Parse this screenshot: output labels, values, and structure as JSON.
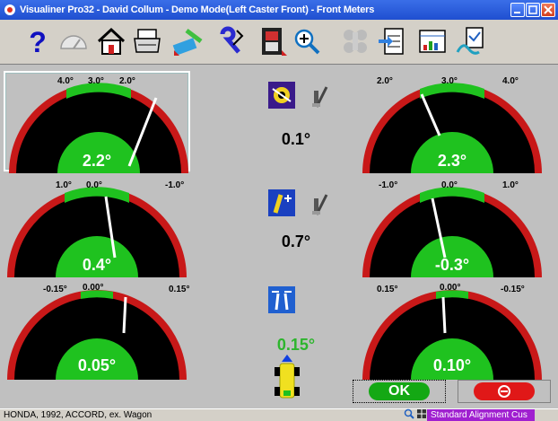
{
  "window": {
    "title": "Visualiner Pro32 - David Collum - Demo Mode(Left Caster Front) - Front Meters"
  },
  "toolbar": {
    "buttons": [
      {
        "icon": "help-icon"
      },
      {
        "icon": "gauge-icon"
      },
      {
        "icon": "home-icon"
      },
      {
        "icon": "printer-icon"
      },
      {
        "icon": "measure-icon"
      },
      {
        "icon": "wrench-icon"
      },
      {
        "icon": "film-icon"
      },
      {
        "icon": "zoom-icon"
      },
      {
        "icon": "wheels-icon"
      },
      {
        "icon": "clipboard-icon"
      },
      {
        "icon": "chart-icon"
      },
      {
        "icon": "report-icon"
      }
    ]
  },
  "gauges": {
    "left_caster": {
      "min_label": "4.0°",
      "center_label": "3.0°",
      "max_label": "2.0°",
      "value": "2.2°"
    },
    "right_caster": {
      "min_label": "2.0°",
      "center_label": "3.0°",
      "max_label": "4.0°",
      "value": "2.3°"
    },
    "left_camber": {
      "min_label": "1.0°",
      "center_label": "0.0°",
      "max_label": "-1.0°",
      "value": "0.4°"
    },
    "right_camber": {
      "min_label": "-1.0°",
      "center_label": "0.0°",
      "max_label": "1.0°",
      "value": "-0.3°"
    },
    "left_toe": {
      "min_label": "-0.15°",
      "center_label": "0.00°",
      "max_label": "0.15°",
      "value": "0.05°"
    },
    "right_toe": {
      "min_label": "0.15°",
      "center_label": "0.00°",
      "max_label": "-0.15°",
      "value": "0.10°"
    }
  },
  "center": {
    "caster_cross": "0.1°",
    "camber_cross": "0.7°",
    "total_toe": "0.15°"
  },
  "buttons": {
    "ok_label": "OK"
  },
  "statusbar": {
    "vehicle": "HONDA, 1992, ACCORD, ex. Wagon",
    "spec": "Standard Alignment Cus"
  },
  "colors": {
    "title_blue": "#1f4fd0",
    "gauge_green": "#1fc21f",
    "gauge_red": "#c81818",
    "ok_green": "#14a814",
    "cancel_red": "#e01818",
    "status_purple": "#a020d0"
  }
}
